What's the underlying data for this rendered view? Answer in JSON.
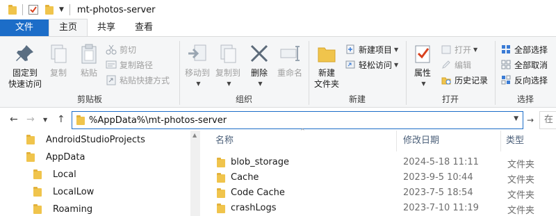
{
  "window": {
    "title": "mt-photos-server"
  },
  "tabs": [
    {
      "label": "文件"
    },
    {
      "label": "主页"
    },
    {
      "label": "共享"
    },
    {
      "label": "查看"
    }
  ],
  "ribbon": {
    "clipboard": {
      "label": "剪贴板",
      "pin_label_line1": "固定到",
      "pin_label_line2": "快速访问",
      "copy_label": "复制",
      "paste_label": "粘贴",
      "cut_label": "剪切",
      "copy_path_label": "复制路径",
      "paste_shortcut_label": "粘贴快捷方式"
    },
    "organize": {
      "label": "组织",
      "move_to_label": "移动到",
      "copy_to_label": "复制到",
      "delete_label": "删除",
      "rename_label": "重命名"
    },
    "new": {
      "label": "新建",
      "new_folder_line1": "新建",
      "new_folder_line2": "文件夹",
      "new_item_label": "新建项目",
      "easy_access_label": "轻松访问"
    },
    "open": {
      "label": "打开",
      "properties_label": "属性",
      "open_label": "打开",
      "edit_label": "编辑",
      "history_label": "历史记录"
    },
    "select": {
      "label": "选择",
      "select_all_label": "全部选择",
      "select_none_label": "全部取消",
      "invert_label": "反向选择"
    }
  },
  "address": {
    "value": "%AppData%\\mt-photos-server",
    "search_placeholder": "在"
  },
  "nav_tree": [
    {
      "label": "AndroidStudioProjects"
    },
    {
      "label": "AppData"
    },
    {
      "label": "Local"
    },
    {
      "label": "LocalLow"
    },
    {
      "label": "Roaming"
    }
  ],
  "file_list": {
    "columns": {
      "name": "名称",
      "modified": "修改日期",
      "type": "类型"
    },
    "rows": [
      {
        "name": "blob_storage",
        "modified": "2024-5-18 11:11",
        "type": "文件夹"
      },
      {
        "name": "Cache",
        "modified": "2023-9-5 10:44",
        "type": "文件夹"
      },
      {
        "name": "Code Cache",
        "modified": "2023-7-5 18:54",
        "type": "文件夹"
      },
      {
        "name": "crashLogs",
        "modified": "2023-7-10 11:19",
        "type": "文件夹"
      }
    ]
  },
  "colors": {
    "accent": "#1c6dc8",
    "folder": "#f0c44c",
    "ribbon_bg": "#f5f6f7"
  }
}
